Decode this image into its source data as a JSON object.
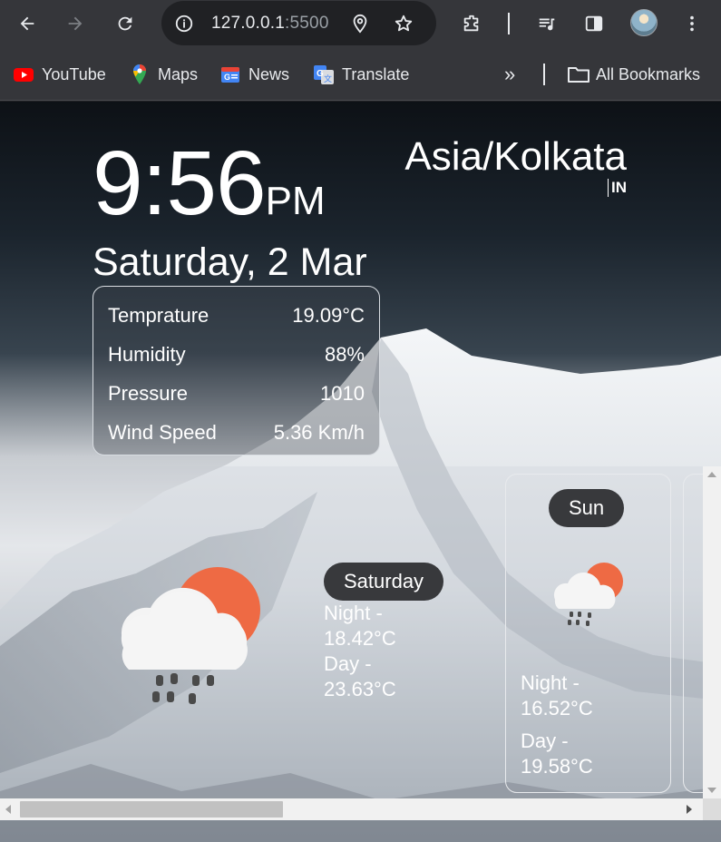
{
  "browser": {
    "url_host": "127.0.0.1",
    "url_port": ":5500",
    "bookmarks": [
      {
        "label": "YouTube",
        "icon": "youtube-icon"
      },
      {
        "label": "Maps",
        "icon": "maps-icon"
      },
      {
        "label": "News",
        "icon": "news-icon"
      },
      {
        "label": "Translate",
        "icon": "translate-icon"
      }
    ],
    "more_bookmarks": "»",
    "all_bookmarks": "All Bookmarks"
  },
  "clock": {
    "time": "9:56",
    "ampm": "PM",
    "date": "Saturday, 2 Mar",
    "timezone": "Asia/Kolkata",
    "country": "IN"
  },
  "current": {
    "rows": [
      {
        "label": "Temprature",
        "value": "19.09°C"
      },
      {
        "label": "Humidity",
        "value": "88%"
      },
      {
        "label": "Pressure",
        "value": "1010"
      },
      {
        "label": "Wind Speed",
        "value": "5.36 Km/h"
      }
    ]
  },
  "forecast": {
    "today": {
      "day": "Saturday",
      "night_label": "Night -",
      "night": "18.42°C",
      "day_label": "Day -",
      "day_temp": "23.63°C",
      "icon": "rain-cloud-sun-icon"
    },
    "cards": [
      {
        "day": "Sun",
        "night_label": "Night -",
        "night": "16.52°C",
        "day_label": "Day -",
        "day_temp": "19.58°C",
        "icon": "rain-cloud-sun-icon"
      }
    ]
  },
  "colors": {
    "sun": "#ee6a44",
    "pill": "#38393c",
    "chrome": "#35363a"
  }
}
